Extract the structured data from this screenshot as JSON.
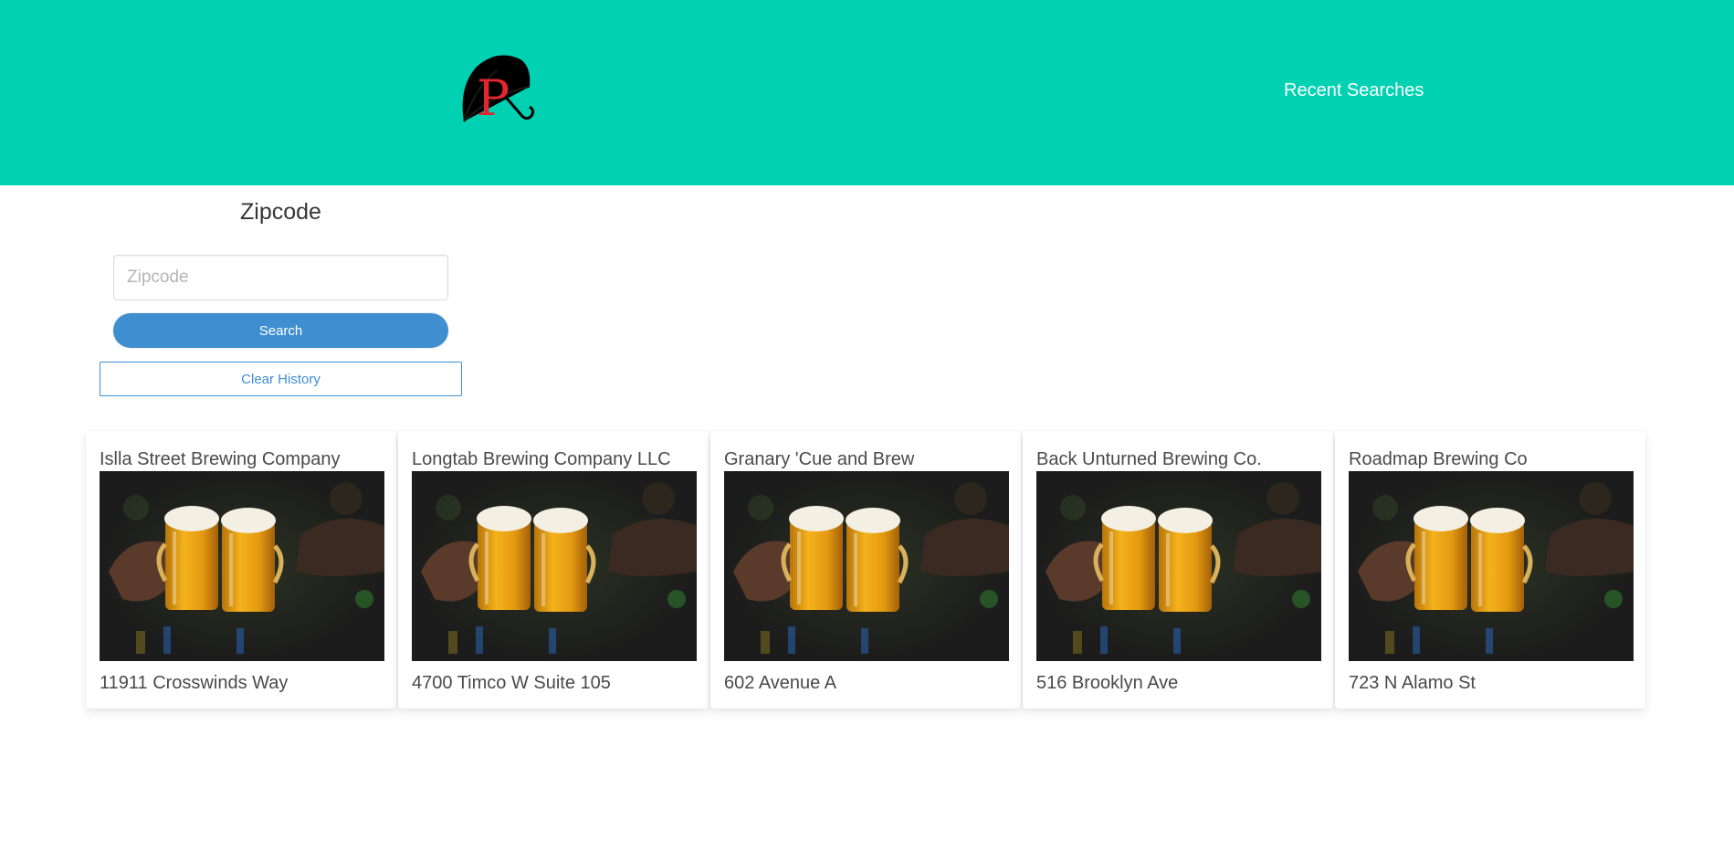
{
  "header": {
    "logo_icon": "umbrella-p-logo-icon",
    "logo_letter": "P",
    "nav_link": "Recent Searches",
    "background": "#00d1b2"
  },
  "search": {
    "title": "Zipcode",
    "input_value": "",
    "input_placeholder": "Zipcode",
    "search_label": "Search",
    "clear_label": "Clear History",
    "accent": "#3e8ed0"
  },
  "breweries": [
    {
      "name": "Islla Street Brewing Company",
      "address": "11911 Crosswinds Way",
      "image_icon": "beer-toast-photo"
    },
    {
      "name": "Longtab Brewing Company LLC",
      "address": "4700 Timco W Suite 105",
      "image_icon": "beer-toast-photo"
    },
    {
      "name": "Granary 'Cue and Brew",
      "address": "602 Avenue A",
      "image_icon": "beer-toast-photo"
    },
    {
      "name": "Back Unturned Brewing Co.",
      "address": "516 Brooklyn Ave",
      "image_icon": "beer-toast-photo"
    },
    {
      "name": "Roadmap Brewing Co",
      "address": "723 N Alamo St",
      "image_icon": "beer-toast-photo"
    }
  ]
}
